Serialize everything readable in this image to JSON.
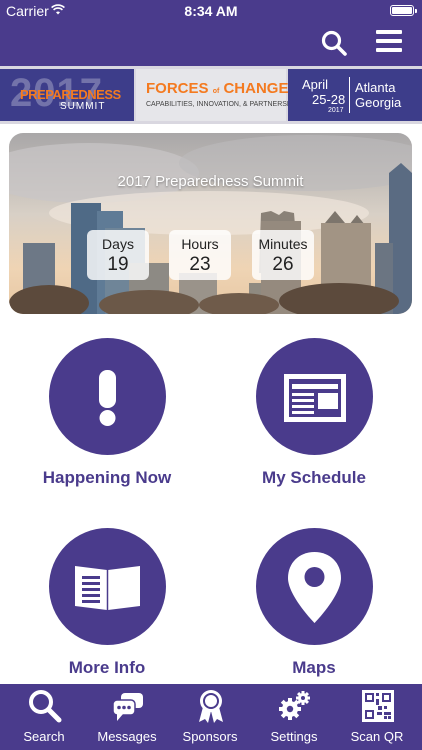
{
  "status_bar": {
    "carrier": "Carrier",
    "time": "8:34 AM"
  },
  "header": {
    "search_icon": "search-icon",
    "menu_icon": "hamburger-menu-icon"
  },
  "banner": {
    "year": "2017",
    "preparedness": "PREPAREDNESS",
    "summit": "SUMMIT",
    "forces": "FORCES",
    "of": "of",
    "change": "CHANGE:",
    "subtitle": "CAPABILITIES, INNOVATION, & PARTNERSHIPS",
    "month": "April",
    "dates": "25-28",
    "date_year": "2017",
    "city": "Atlanta",
    "state": "Georgia"
  },
  "hero": {
    "title": "2017 Preparedness Summit",
    "countdown": [
      {
        "label": "Days",
        "value": "19"
      },
      {
        "label": "Hours",
        "value": "23"
      },
      {
        "label": "Minutes",
        "value": "26"
      }
    ]
  },
  "tiles": [
    {
      "label": "Happening Now",
      "icon": "exclamation-icon"
    },
    {
      "label": "My Schedule",
      "icon": "newspaper-icon"
    },
    {
      "label": "More Info",
      "icon": "open-book-icon"
    },
    {
      "label": "Maps",
      "icon": "map-pin-icon"
    }
  ],
  "tabs": [
    {
      "label": "Search",
      "icon": "search-icon"
    },
    {
      "label": "Messages",
      "icon": "chat-bubbles-icon"
    },
    {
      "label": "Sponsors",
      "icon": "ribbon-badge-icon"
    },
    {
      "label": "Settings",
      "icon": "gears-icon"
    },
    {
      "label": "Scan QR",
      "icon": "qr-code-icon"
    }
  ],
  "colors": {
    "brand": "#4a3b8c",
    "accent": "#f47a20",
    "tile_label": "#4a3b8c"
  }
}
